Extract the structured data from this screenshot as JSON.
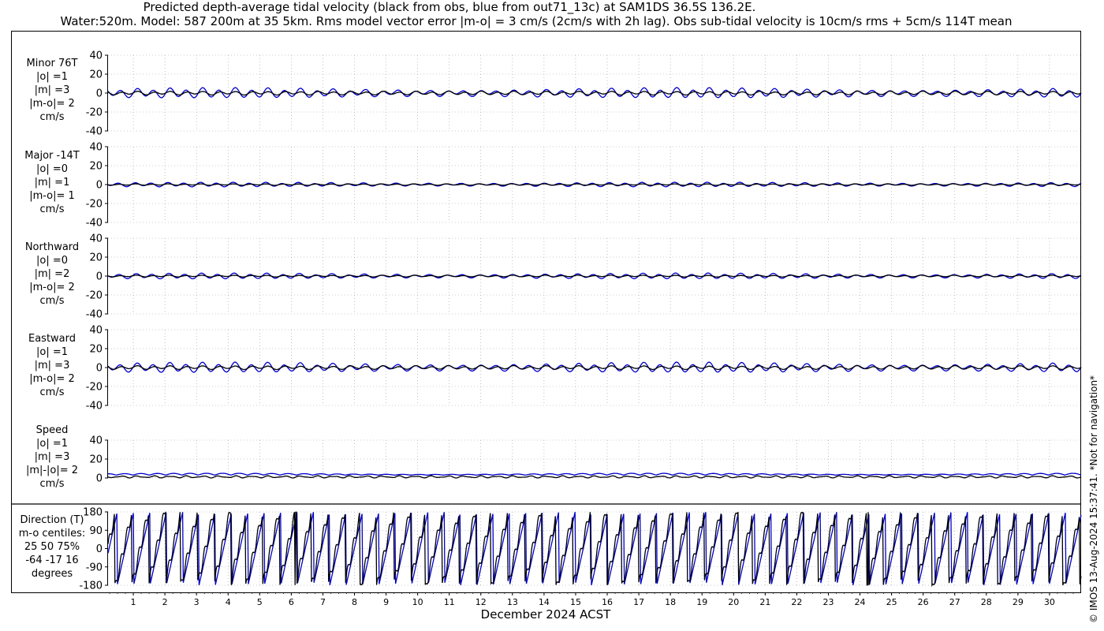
{
  "header": {
    "title_line1": "Predicted depth-average tidal velocity (black from obs, blue from out71_13c) at SAM1DS 36.5S 136.2E.",
    "title_line2": "Water:520m. Model: 587 200m at 35 5km. Rms model vector error |m-o| = 3 cm/s (2cm/s with 2h lag). Obs sub-tidal velocity is 10cm/s rms + 5cm/s 114T mean"
  },
  "copyright": "© IMOS 13-Aug-2024 15:37:41. *Not for navigation*",
  "colors": {
    "obs": "#000000",
    "model": "#0000cc",
    "grid": "#999999"
  },
  "chart_data": {
    "type": "line",
    "xlabel": "December 2024 ACST",
    "x_ticks": [
      "1",
      "2",
      "3",
      "4",
      "5",
      "6",
      "7",
      "8",
      "9",
      "10",
      "11",
      "12",
      "13",
      "14",
      "15",
      "16",
      "17",
      "18",
      "19",
      "20",
      "21",
      "22",
      "23",
      "24",
      "25",
      "26",
      "27",
      "28",
      "29",
      "30"
    ],
    "xlim_days": [
      0.2,
      31.0
    ],
    "grid": true,
    "series_legend": {
      "obs": "black",
      "model": "blue"
    },
    "panels": [
      {
        "id": "minor",
        "label_lines": [
          "Minor 76T",
          "|o| =1",
          "|m| =3",
          "|m-o|= 2",
          "cm/s"
        ],
        "ylim": [
          -40,
          40
        ],
        "yticks": [
          "40",
          "20",
          "0",
          "-20",
          "-40"
        ],
        "obs_amp": 1.5,
        "model_amp": 4.5
      },
      {
        "id": "major",
        "label_lines": [
          "Major -14T",
          "|o| =0",
          "|m| =1",
          "|m-o|= 1",
          "cm/s"
        ],
        "ylim": [
          -40,
          40
        ],
        "yticks": [
          "40",
          "20",
          "0",
          "-20",
          "-40"
        ],
        "obs_amp": 0.6,
        "model_amp": 2.0
      },
      {
        "id": "north",
        "label_lines": [
          "Northward",
          "|o| =0",
          "|m| =2",
          "|m-o|= 2",
          "cm/s"
        ],
        "ylim": [
          -40,
          40
        ],
        "yticks": [
          "40",
          "20",
          "0",
          "-20",
          "-40"
        ],
        "obs_amp": 0.7,
        "model_amp": 2.5
      },
      {
        "id": "east",
        "label_lines": [
          "Eastward",
          "|o| =1",
          "|m| =3",
          "|m-o|= 2",
          "cm/s"
        ],
        "ylim": [
          -40,
          40
        ],
        "yticks": [
          "40",
          "20",
          "0",
          "-20",
          "-40"
        ],
        "obs_amp": 1.5,
        "model_amp": 4.5
      },
      {
        "id": "speed",
        "label_lines": [
          "Speed",
          "|o| =1",
          "|m| =3",
          "|m|-|o|= 2",
          "cm/s"
        ],
        "ylim": [
          0,
          40
        ],
        "yticks": [
          "40",
          "20",
          "0"
        ],
        "obs_mean": 1.2,
        "model_mean": 3.0
      },
      {
        "id": "direction",
        "label_lines": [
          "Direction (T)",
          "m-o centiles:",
          "25  50  75%",
          "-64 -17  16",
          "degrees"
        ],
        "ylim": [
          -180,
          180
        ],
        "yticks": [
          "180",
          "90",
          "0",
          "-90",
          "-180"
        ]
      }
    ]
  }
}
